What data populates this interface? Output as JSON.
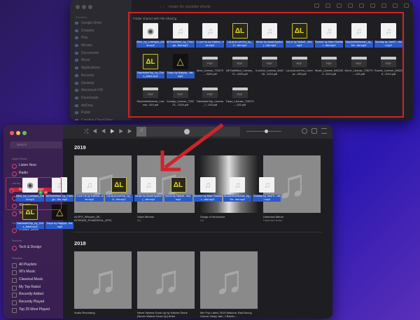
{
  "finder": {
    "title": "music for youtube shorts",
    "sidebar_header": "Favorites",
    "sidebar": [
      "Google Drive",
      "Dropbox",
      "Play",
      "Movies",
      "Documents",
      "Music",
      "Applications",
      "Recents",
      "Desktop",
      "Macintosh HD",
      "Downloads",
      "AirDrop",
      "Public",
      "Creative Cloud Files"
    ],
    "folder_header": "Folder shared with File Sharing",
    "files": [
      {
        "name": "Alive_by_Lustrapla_Artist.mp3",
        "icon": "disc"
      },
      {
        "name": "AllThatIWant_by_TheLigh...ttist.mp3",
        "icon": "note"
      },
      {
        "name": "I Love Us by Katrina...rtist.mp3",
        "icon": "note"
      },
      {
        "name": "LaLaLaLoveYou_by_D...tist.mp3",
        "icon": "al"
      },
      {
        "name": "Music by Assaf Ayalon (...tist.mp3",
        "icon": "note"
      },
      {
        "name": "NoLie by Nabofi...rtist.mp3",
        "icon": "al"
      },
      {
        "name": "Runnin' by Marc Robillar...rtist.mp3",
        "icon": "note"
      },
      {
        "name": "Stuckinthebloman_by_De...tist.mp3",
        "icon": "note"
      },
      {
        "name": "Sunday by JackTr...rtist.mp3",
        "icon": "note"
      },
      {
        "name": "TakeItotheTop_by_Chris_Artist.mp3",
        "icon": "al"
      },
      {
        "name": "Tokyo by Niqtyhp...tist.mp3",
        "icon": "tri"
      },
      {
        "name": "Alive_License_725279-...2020.pdf",
        "icon": "pdf"
      },
      {
        "name": "AllThatIWant_License_72...2020.pdf",
        "icon": "pdf"
      },
      {
        "name": "ILoveUs_License_846226...2019.pdf",
        "icon": "pdf"
      },
      {
        "name": "LaLaLaLoveYou_License...020.pdf",
        "icon": "pdf"
      },
      {
        "name": "Music_License_8462262...2019.pdf",
        "icon": "pdf"
      },
      {
        "name": "NoLie_License_725279-...020.pdf",
        "icon": "pdf"
      },
      {
        "name": "Runnin_License_846226...2019.pdf",
        "icon": "pdf"
      },
      {
        "name": "Stuckinthebloman_License...020.pdf",
        "icon": "pdf"
      },
      {
        "name": "Sunday_License_725279-...2020.pdf",
        "icon": "pdf"
      },
      {
        "name": "TakeItotheTop_License_7...020.pdf",
        "icon": "pdf"
      },
      {
        "name": "Tokyo_License_725279-...020.pdf",
        "icon": "pdf"
      }
    ]
  },
  "music": {
    "search_placeholder": "Search",
    "sections": [
      {
        "label": "Apple Music",
        "items": [
          "Listen Now",
          "Radio"
        ]
      },
      {
        "label": "Library",
        "items": [
          "Recently Added",
          "Artists",
          "Albums",
          "Songs"
        ]
      },
      {
        "label": "Store",
        "items": [
          "iTunes Store"
        ]
      },
      {
        "label": "Devices",
        "items": [
          "Tech & Design"
        ]
      },
      {
        "label": "Playlists",
        "items": [
          "All Playlists",
          "90's Music",
          "Classical Music",
          "My Top Rated",
          "Recently Added",
          "Recently Played",
          "Top 25 Most Played"
        ]
      }
    ],
    "active_item": "Recently Added",
    "years": [
      {
        "year": "2019",
        "albums": [
          {
            "title": "ALSFX_Whoosh_08 - INTENSE_POWERFUL_EPIC",
            "artist": ""
          },
          {
            "title": "Voice Memos",
            "artist": "AC"
          },
          {
            "title": "Songs of Innocence",
            "artist": "U2",
            "photo": true
          },
          {
            "title": "Unknown Album",
            "artist": "Unknown Artist"
          }
        ]
      },
      {
        "year": "2018",
        "albums": [
          {
            "title": "Audio Recording",
            "artist": ""
          },
          {
            "title": "Never Wanna Grow Up by Katrina Stone (Never Wanna Grow Up) Artist",
            "artist": ""
          },
          {
            "title": "Mix Pop Latino 2019 Maluma, Bad Bunny, Ozuna, Nicky Jam, J Balvin,...",
            "artist": ""
          }
        ]
      }
    ]
  },
  "drag_count": "19",
  "colors": {
    "selection": "#2b5ac7",
    "highlight": "#d0232a",
    "accent": "#c8243a"
  }
}
